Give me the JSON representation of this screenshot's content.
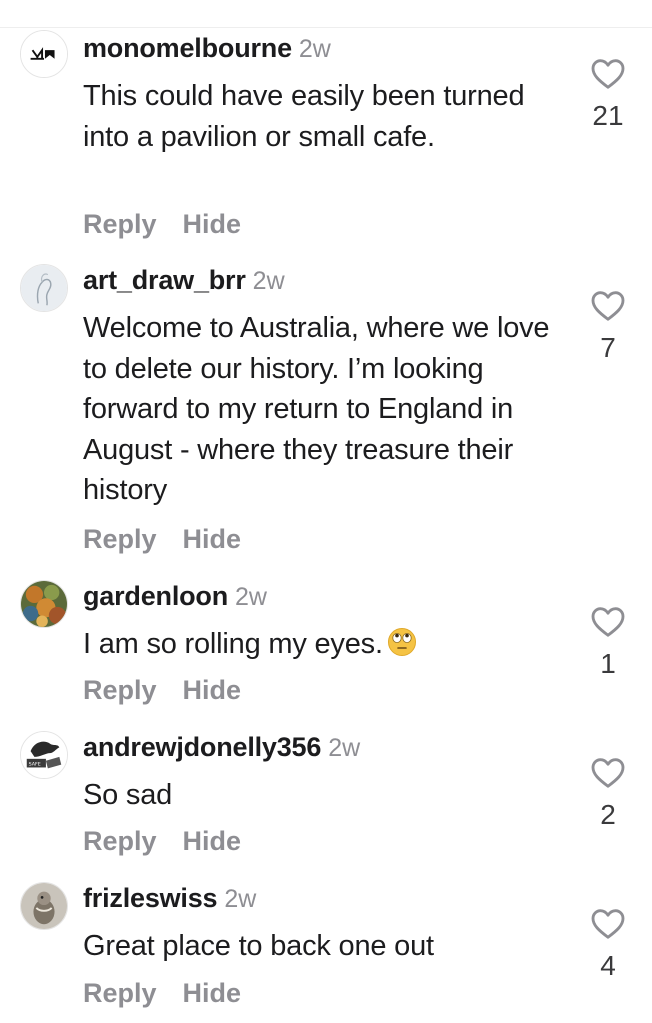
{
  "comments": [
    {
      "username": "monomelbourne",
      "time": "2w",
      "text": "This could have easily been turned into a pavilion or small cafe.",
      "reply_label": "Reply",
      "hide_label": "Hide",
      "likes": "21",
      "avatar_icon": "mono-logo-avatar"
    },
    {
      "username": "art_draw_brr",
      "time": "2w",
      "text": "Welcome to Australia, where we love to delete our history. I’m looking forward to my return to England in August - where they treasure their history",
      "reply_label": "Reply",
      "hide_label": "Hide",
      "likes": "7",
      "avatar_icon": "sketch-avatar"
    },
    {
      "username": "gardenloon",
      "time": "2w",
      "text": "I am so rolling my eyes.",
      "emoji": "face-with-rolling-eyes-emoji",
      "reply_label": "Reply",
      "hide_label": "Hide",
      "likes": "1",
      "avatar_icon": "autumn-leaves-avatar"
    },
    {
      "username": "andrewjdonelly356",
      "time": "2w",
      "text": "So sad",
      "reply_label": "Reply",
      "hide_label": "Hide",
      "likes": "2",
      "avatar_icon": "horse-sign-avatar"
    },
    {
      "username": "frizleswiss",
      "time": "2w",
      "text": "Great place to back one out",
      "reply_label": "Reply",
      "hide_label": "Hide",
      "likes": "4",
      "avatar_icon": "bird-avatar"
    }
  ],
  "colors": {
    "text": "#1c1c1e",
    "secondary": "#8e8e93",
    "like_outline": "#8e8e93"
  }
}
